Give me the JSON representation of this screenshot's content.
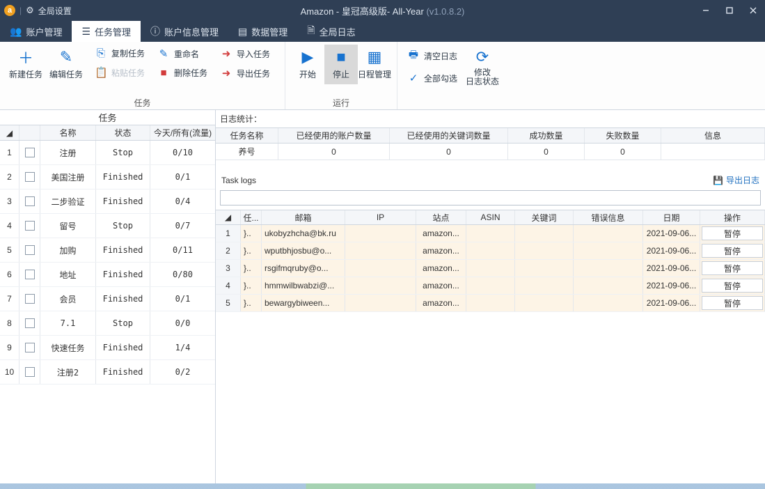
{
  "titlebar": {
    "globalSettings": "全局设置",
    "appTitle": "Amazon  - 皇冠高级版- All-Year ",
    "version": "(v1.0.8.2)"
  },
  "mainTabs": {
    "account": "账户管理",
    "task": "任务管理",
    "accountInfo": "账户信息管理",
    "data": "数据管理",
    "globalLog": "全局日志"
  },
  "ribbon": {
    "newTask": "新建任务",
    "editTask": "编辑任务",
    "copyTask": "复制任务",
    "pasteTask": "粘贴任务",
    "rename": "重命名",
    "deleteTask": "删除任务",
    "importTask": "导入任务",
    "exportTask": "导出任务",
    "groupTask": "任务",
    "start": "开始",
    "stop": "停止",
    "schedule": "日程管理",
    "groupRun": "运行",
    "clearLog": "清空日志",
    "selectAll": "全部勾选",
    "modifyLogStatus": "修改\n日志状态"
  },
  "leftPane": {
    "title": "任务",
    "head": {
      "name": "名称",
      "status": "状态",
      "flow": "今天/所有(流量)"
    },
    "rows": [
      {
        "n": "1",
        "name": "注册",
        "status": "Stop",
        "flow": "0/10"
      },
      {
        "n": "2",
        "name": "美国注册",
        "status": "Finished",
        "flow": "0/1"
      },
      {
        "n": "3",
        "name": "二步验证",
        "status": "Finished",
        "flow": "0/4"
      },
      {
        "n": "4",
        "name": "留号",
        "status": "Stop",
        "flow": "0/7"
      },
      {
        "n": "5",
        "name": "加购",
        "status": "Finished",
        "flow": "0/11"
      },
      {
        "n": "6",
        "name": "地址",
        "status": "Finished",
        "flow": "0/80"
      },
      {
        "n": "7",
        "name": "会员",
        "status": "Finished",
        "flow": "0/1"
      },
      {
        "n": "8",
        "name": "7.1",
        "status": "Stop",
        "flow": "0/0"
      },
      {
        "n": "9",
        "name": "快速任务",
        "status": "Finished",
        "flow": "1/4"
      },
      {
        "n": "10",
        "name": "注册2",
        "status": "Finished",
        "flow": "0/2"
      }
    ]
  },
  "stats": {
    "label": "日志统计：",
    "head": {
      "name": "任务名称",
      "acc": "已经使用的账户数量",
      "kw": "已经使用的关键词数量",
      "ok": "成功数量",
      "fail": "失败数量",
      "info": "信息"
    },
    "row": {
      "name": "养号",
      "acc": "0",
      "kw": "0",
      "ok": "0",
      "fail": "0",
      "info": ""
    }
  },
  "taskLogs": {
    "title": "Task logs",
    "export": "导出日志",
    "head": {
      "task": "任...",
      "mail": "邮箱",
      "ip": "IP",
      "site": "站点",
      "asin": "ASIN",
      "kw": "关键词",
      "err": "错误信息",
      "date": "日期",
      "op": "操作"
    },
    "rows": [
      {
        "n": "1",
        "task": "}..",
        "mail": "ukobyzhcha@bk.ru",
        "site": "amazon...",
        "date": "2021-09-06...",
        "op": "暂停"
      },
      {
        "n": "2",
        "task": "}..",
        "mail": "wputbhjosbu@o...",
        "site": "amazon...",
        "date": "2021-09-06...",
        "op": "暂停"
      },
      {
        "n": "3",
        "task": "}..",
        "mail": "rsgifmqruby@o...",
        "site": "amazon...",
        "date": "2021-09-06...",
        "op": "暂停"
      },
      {
        "n": "4",
        "task": "}..",
        "mail": "hmmwilbwabzi@...",
        "site": "amazon...",
        "date": "2021-09-06...",
        "op": "暂停"
      },
      {
        "n": "5",
        "task": "}..",
        "mail": "bewargybiween...",
        "site": "amazon...",
        "date": "2021-09-06...",
        "op": "暂停"
      }
    ]
  }
}
